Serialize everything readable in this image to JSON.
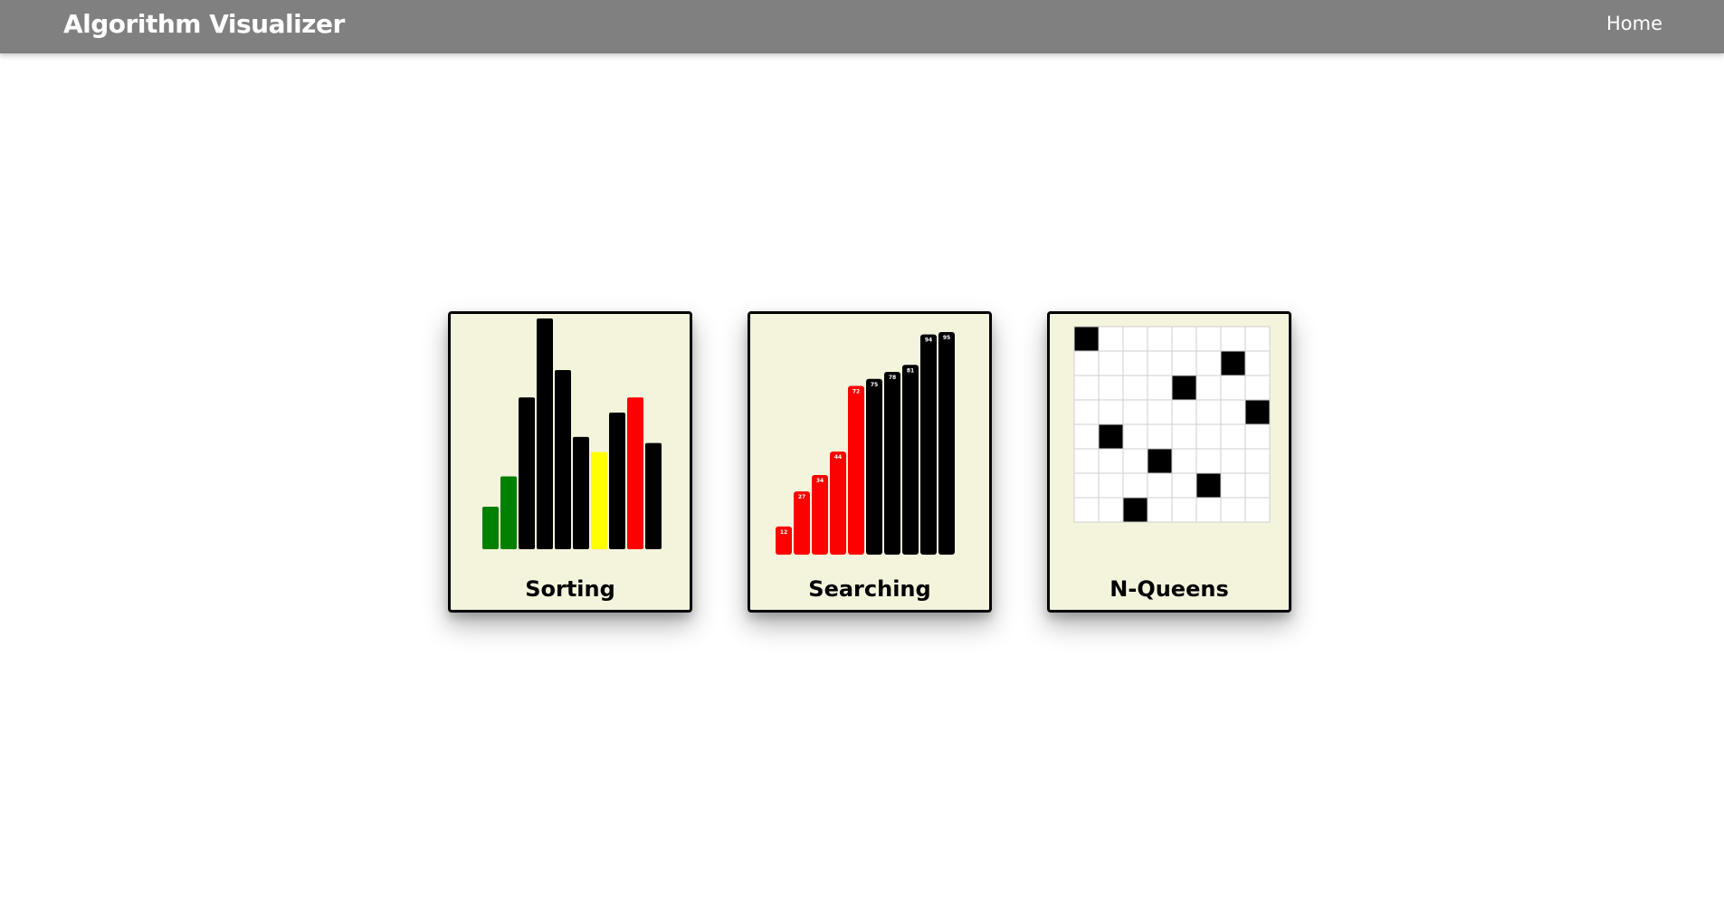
{
  "navbar": {
    "brand": "Algorithm Visualizer",
    "home_label": "Home",
    "background_color": "#808080"
  },
  "cards": [
    {
      "id": "sorting",
      "label": "Sorting",
      "preview": "sorting-bars",
      "bars": [
        {
          "value": 14,
          "status": "sorted"
        },
        {
          "value": 24,
          "status": "sorted"
        },
        {
          "value": 50,
          "status": "unsorted"
        },
        {
          "value": 76,
          "status": "unsorted"
        },
        {
          "value": 59,
          "status": "unsorted"
        },
        {
          "value": 37,
          "status": "unsorted"
        },
        {
          "value": 32,
          "status": "current"
        },
        {
          "value": 45,
          "status": "unsorted"
        },
        {
          "value": 50,
          "status": "compared"
        },
        {
          "value": 35,
          "status": "unsorted"
        }
      ]
    },
    {
      "id": "searching",
      "label": "Searching",
      "preview": "searching-bars",
      "bars": [
        {
          "value": 12,
          "status": "eliminated"
        },
        {
          "value": 27,
          "status": "eliminated"
        },
        {
          "value": 34,
          "status": "eliminated"
        },
        {
          "value": 44,
          "status": "eliminated"
        },
        {
          "value": 72,
          "status": "eliminated"
        },
        {
          "value": 75,
          "status": "remaining"
        },
        {
          "value": 78,
          "status": "remaining"
        },
        {
          "value": 81,
          "status": "remaining"
        },
        {
          "value": 94,
          "status": "remaining"
        },
        {
          "value": 95,
          "status": "remaining"
        }
      ]
    },
    {
      "id": "n-queens",
      "label": "N-Queens",
      "preview": "queens-board",
      "board_size": 8,
      "queen_columns_by_row": [
        0,
        6,
        4,
        7,
        1,
        3,
        5,
        2
      ]
    }
  ],
  "colors": {
    "sorted": "#008000",
    "unsorted": "#000000",
    "current": "#ffff00",
    "compared": "#ff0000",
    "eliminated": "#ff0000",
    "remaining": "#000000",
    "queen": "#000000",
    "cell": "#ffffff",
    "card_bg": "#f4f3dc"
  }
}
